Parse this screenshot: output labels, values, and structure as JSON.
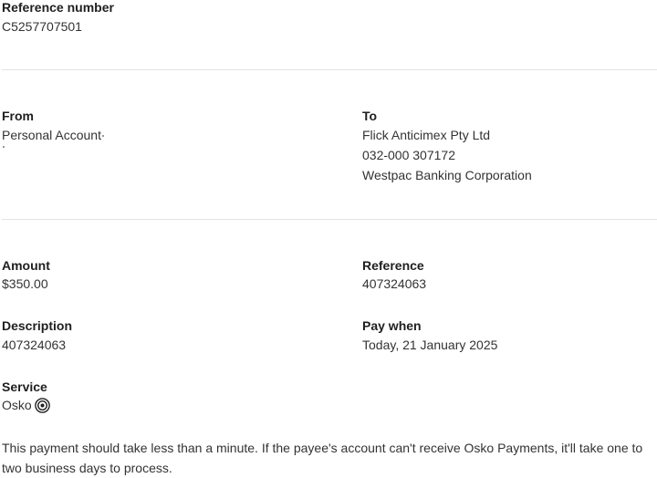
{
  "reference_number": {
    "label": "Reference number",
    "value": "C5257707501"
  },
  "from": {
    "label": "From",
    "account_name": "Personal Account"
  },
  "to": {
    "label": "To",
    "payee_name": "Flick Anticimex Pty Ltd",
    "bsb_account": "032-000 307172",
    "bank": "Westpac Banking Corporation"
  },
  "amount": {
    "label": "Amount",
    "value": "$350.00"
  },
  "reference": {
    "label": "Reference",
    "value": "407324063"
  },
  "description": {
    "label": "Description",
    "value": "407324063"
  },
  "pay_when": {
    "label": "Pay when",
    "value": "Today, 21 January 2025"
  },
  "service": {
    "label": "Service",
    "value": "Osko",
    "icon": "osko-logo-icon"
  },
  "note": "This payment should take less than a minute. If the payee's account can't receive Osko Payments, it'll take one to two business days to process."
}
